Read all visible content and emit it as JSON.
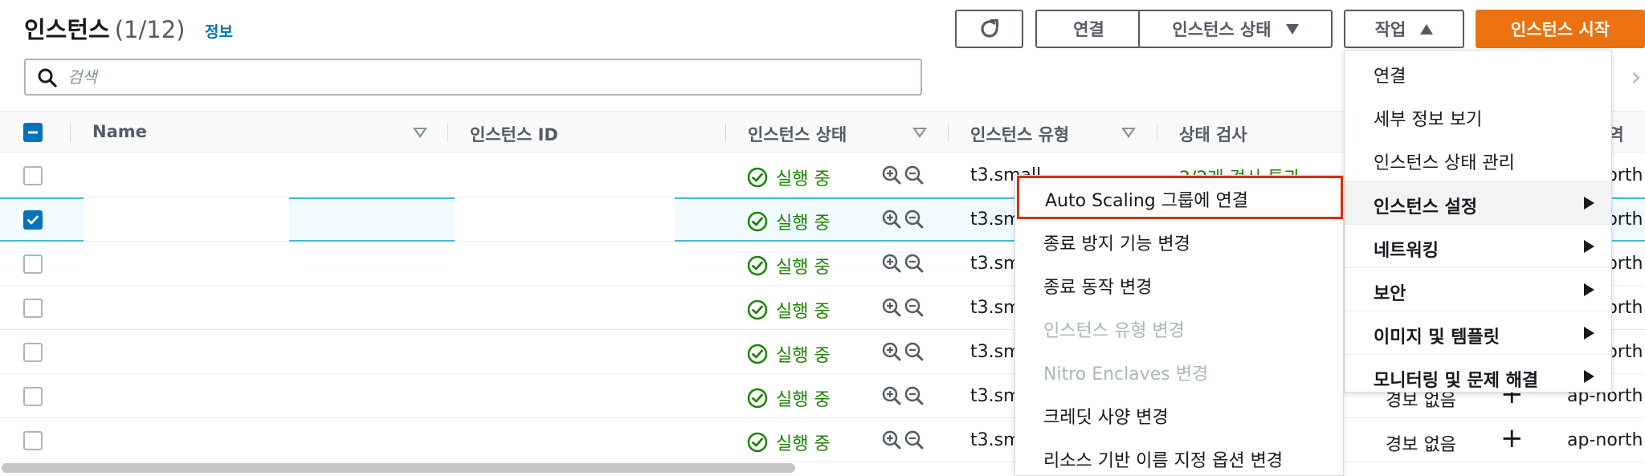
{
  "header": {
    "title": "인스턴스",
    "count": "(1/12)",
    "info_link": "정보"
  },
  "toolbar": {
    "connect_label": "연결",
    "instance_state_label": "인스턴스 상태",
    "actions_label": "작업",
    "launch_label": "인스턴스 시작"
  },
  "search": {
    "placeholder": "검색"
  },
  "table": {
    "columns": {
      "name": "Name",
      "instance_id": "인스턴스 ID",
      "instance_state": "인스턴스 상태",
      "instance_type": "인스턴스 유형",
      "status_check": "상태 검사",
      "region": "경역"
    },
    "rows": [
      {
        "checked": false,
        "state": "실행 중",
        "type": "t3.small",
        "alarm": "",
        "region": "ap-north"
      },
      {
        "checked": true,
        "state": "실행 중",
        "type": "t3.sm",
        "alarm": "",
        "region": "ap-north"
      },
      {
        "checked": false,
        "state": "실행 중",
        "type": "t3.sm",
        "alarm": "",
        "region": "ap-north"
      },
      {
        "checked": false,
        "state": "실행 중",
        "type": "t3.sm",
        "alarm": "",
        "region": "ap-north"
      },
      {
        "checked": false,
        "state": "실행 중",
        "type": "t3.sm",
        "alarm": "",
        "region": "ap-north"
      },
      {
        "checked": false,
        "state": "실행 중",
        "type": "t3.sm",
        "alarm": "경보 없음",
        "region": "ap-north"
      },
      {
        "checked": false,
        "state": "실행 중",
        "type": "t3.sm",
        "alarm": "경보 없음",
        "region": "ap-north"
      }
    ],
    "status_check_partial": "2/2개 검사 통과"
  },
  "actions_menu": {
    "items": [
      {
        "label": "연결"
      },
      {
        "label": "세부 정보 보기"
      },
      {
        "label": "인스턴스 상태 관리"
      },
      {
        "label": "인스턴스 설정"
      },
      {
        "label": "네트워킹"
      },
      {
        "label": "보안"
      },
      {
        "label": "이미지 및 템플릿"
      },
      {
        "label": "모니터링 및 문제 해결"
      }
    ]
  },
  "settings_submenu": {
    "items": [
      {
        "label": "Auto Scaling 그룹에 연결"
      },
      {
        "label": "종료 방지 기능 변경"
      },
      {
        "label": "종료 동작 변경"
      },
      {
        "label": "인스턴스 유형 변경"
      },
      {
        "label": "Nitro Enclaves 변경"
      },
      {
        "label": "크레딧 사양 변경"
      },
      {
        "label": "리소스 기반 이름 지정 옵션 변경"
      }
    ]
  },
  "colors": {
    "primary_orange": "#ec7211",
    "link_blue": "#0073bb",
    "success_green": "#1d8102",
    "focus_red": "#d13212"
  }
}
